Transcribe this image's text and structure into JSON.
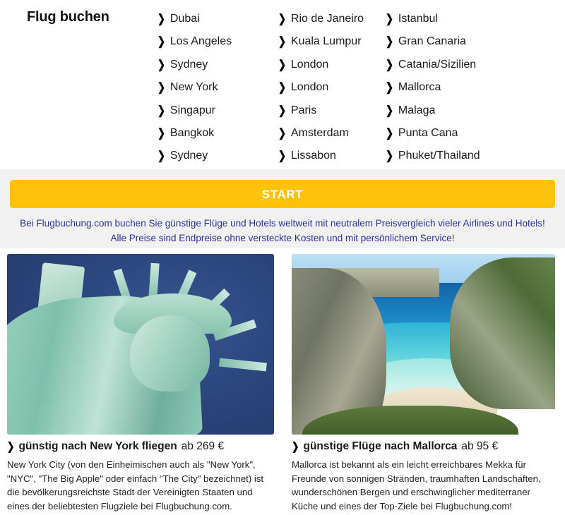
{
  "picker": {
    "title": "Flug buchen",
    "bullet": "❯",
    "columns": [
      {
        "items": [
          "Dubai",
          "Los Angeles",
          "Sydney",
          "New York",
          "Singapur",
          "Bangkok",
          "Sydney"
        ]
      },
      {
        "items": [
          "Rio de Janeiro",
          "Kuala Lumpur",
          "London",
          "London",
          "Paris",
          "Amsterdam",
          "Lissabon"
        ]
      },
      {
        "items": [
          "Istanbul",
          "Gran Canaria",
          "Catania/Sizilien",
          "Mallorca",
          "Malaga",
          "Punta Cana",
          "Phuket/Thailand"
        ]
      }
    ]
  },
  "band": {
    "start_label": "START",
    "blurb": "Bei Flugbuchung.com buchen Sie günstige Flüge und Hotels weltweit mit neutralem Preisvergleich vieler Airlines und Hotels! Alle Preise sind Endpreise ohne versteckte Kosten und mit persönlichem Service!"
  },
  "cards": [
    {
      "photo_alt": "statue-of-liberty-new-york",
      "title": "günstig nach New York fliegen",
      "price": "ab 269 €",
      "text": "New York City (von den Einheimischen auch als \"New York\", \"NYC\", \"The Big Apple\" oder einfach \"The City\" bezeichnet) ist die bevölkerungsreichste Stadt der Vereinigten Staaten und eines der beliebtesten Flugziele bei Flugbuchung.com."
    },
    {
      "photo_alt": "turquoise-cove-beach-mallorca",
      "title": "günstige Flüge nach Mallorca",
      "price": "ab 95 €",
      "text": "Mallorca ist bekannt als ein leicht erreichbares Mekka für Freunde von sonnigen Stränden, traumhaften Landschaften, wunderschönen Bergen und erschwinglicher mediterraner Küche und eines der Top-Ziele bei Flugbuchung.com!"
    }
  ],
  "colors": {
    "start_button": "#ffc20a",
    "blurb_text": "#2e3192",
    "band_background": "#f1f1f1"
  }
}
